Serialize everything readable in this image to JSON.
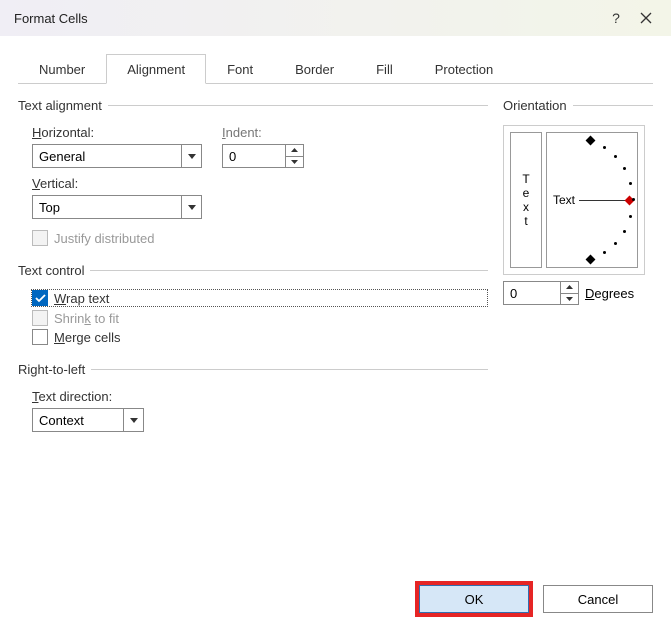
{
  "dialog": {
    "title": "Format Cells"
  },
  "tabs": {
    "number": "Number",
    "alignment": "Alignment",
    "font": "Font",
    "border": "Border",
    "fill": "Fill",
    "protection": "Protection"
  },
  "groups": {
    "text_alignment": "Text alignment",
    "text_control": "Text control",
    "rtl": "Right-to-left",
    "orientation": "Orientation"
  },
  "alignment": {
    "horizontal_label": "Horizontal:",
    "horizontal_value": "General",
    "vertical_label": "Vertical:",
    "vertical_value": "Top",
    "indent_label": "Indent:",
    "indent_value": "0",
    "justify_distributed": "Justify distributed"
  },
  "text_control": {
    "wrap_text": "Wrap text",
    "shrink_to_fit": "Shrink to fit",
    "merge_cells": "Merge cells"
  },
  "rtl": {
    "direction_label": "Text direction:",
    "direction_value": "Context"
  },
  "orientation": {
    "vtext": [
      "T",
      "e",
      "x",
      "t"
    ],
    "htext": "Text",
    "degrees_value": "0",
    "degrees_label": "Degrees"
  },
  "buttons": {
    "ok": "OK",
    "cancel": "Cancel"
  }
}
